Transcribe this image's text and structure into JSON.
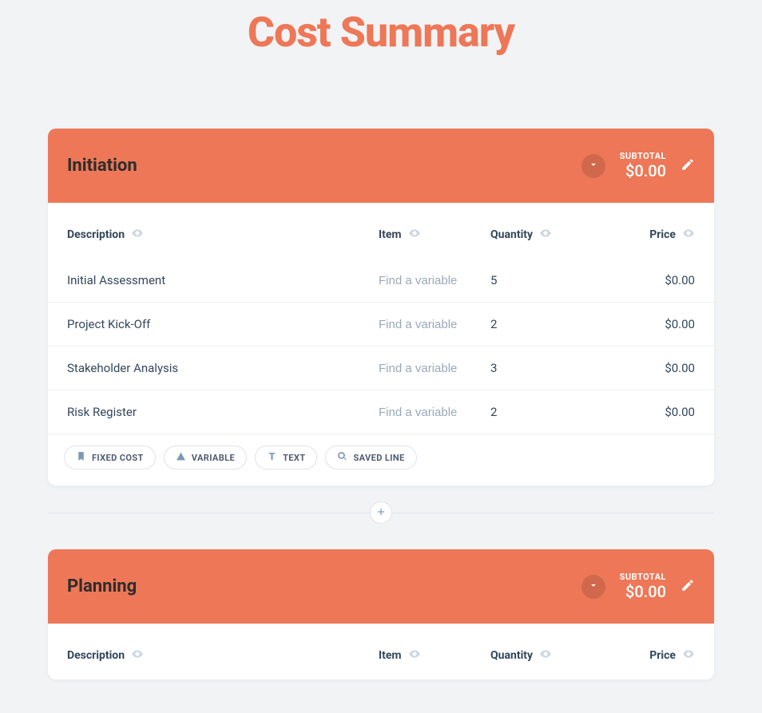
{
  "page": {
    "title": "Cost Summary"
  },
  "columns": {
    "description": "Description",
    "item": "Item",
    "quantity": "Quantity",
    "price": "Price"
  },
  "placeholders": {
    "find_variable": "Find a variable"
  },
  "pills": {
    "fixed_cost": "FIXED COST",
    "variable": "VARIABLE",
    "text": "TEXT",
    "saved_line": "SAVED LINE"
  },
  "subtotal_label": "SUBTOTAL",
  "sections": [
    {
      "title": "Initiation",
      "subtotal": "$0.00",
      "rows": [
        {
          "description": "Initial Assessment",
          "quantity": "5",
          "price": "$0.00"
        },
        {
          "description": "Project Kick-Off",
          "quantity": "2",
          "price": "$0.00"
        },
        {
          "description": "Stakeholder Analysis",
          "quantity": "3",
          "price": "$0.00"
        },
        {
          "description": "Risk Register",
          "quantity": "2",
          "price": "$0.00"
        }
      ]
    },
    {
      "title": "Planning",
      "subtotal": "$0.00",
      "rows": []
    }
  ]
}
